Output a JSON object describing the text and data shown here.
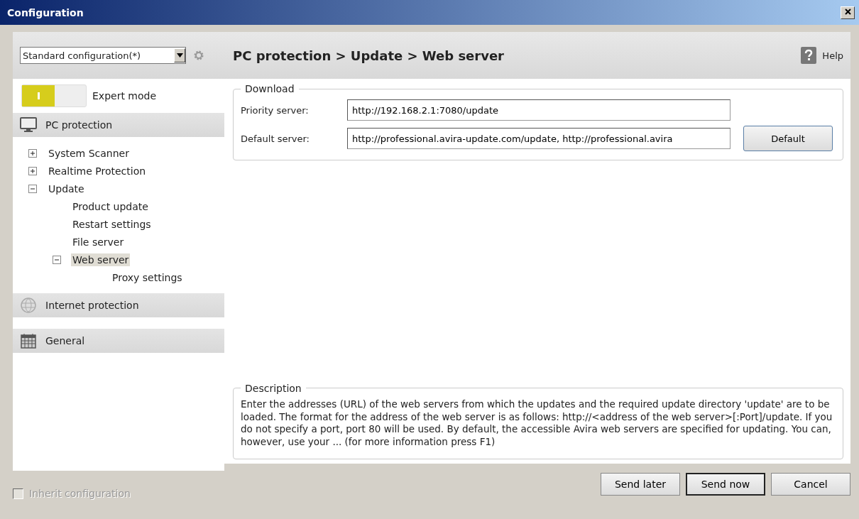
{
  "window": {
    "title": "Configuration"
  },
  "profile": {
    "value": "Standard configuration(*)"
  },
  "expert_mode": {
    "label": "Expert mode",
    "on": true
  },
  "sections": [
    {
      "label": "PC protection",
      "kind": "monitor",
      "children": [
        {
          "label": "System Scanner",
          "expanded": false,
          "selected": false
        },
        {
          "label": "Realtime Protection",
          "expanded": false,
          "selected": false
        },
        {
          "label": "Update",
          "expanded": true,
          "selected": false,
          "children": [
            {
              "label": "Product update",
              "selected": false
            },
            {
              "label": "Restart settings",
              "selected": false
            },
            {
              "label": "File server",
              "selected": false
            },
            {
              "label": "Web server",
              "expanded": true,
              "selected": true,
              "children": [
                {
                  "label": "Proxy settings",
                  "selected": false
                }
              ]
            }
          ]
        }
      ]
    },
    {
      "label": "Internet protection",
      "kind": "globe"
    },
    {
      "label": "General",
      "kind": "calendar"
    }
  ],
  "breadcrumb": "PC protection > Update > Web server",
  "help": "Help",
  "download": {
    "title": "Download",
    "fields": [
      {
        "label": "Priority server:",
        "value": "http://192.168.2.1:7080/update"
      },
      {
        "label": "Default server:",
        "value": "http://professional.avira-update.com/update, http://professional.avira"
      }
    ],
    "default_button": "Default"
  },
  "description": {
    "title": "Description",
    "text": "Enter the addresses (URL) of the web servers from which the updates and the required update directory 'update' are to be loaded. The format for the address of the web server is as follows: http://<address of the web server>[:Port]/update. If you do not specify a port, port 80 will be used. By default, the accessible Avira web servers are specified for updating. You can, however, use your  ...  (for more information press F1)"
  },
  "inherit": {
    "label": "Inherit configuration",
    "checked": false,
    "disabled": true
  },
  "buttons": [
    {
      "label": "Send later",
      "default": false
    },
    {
      "label": "Send now",
      "default": true
    },
    {
      "label": "Cancel",
      "default": false
    }
  ]
}
